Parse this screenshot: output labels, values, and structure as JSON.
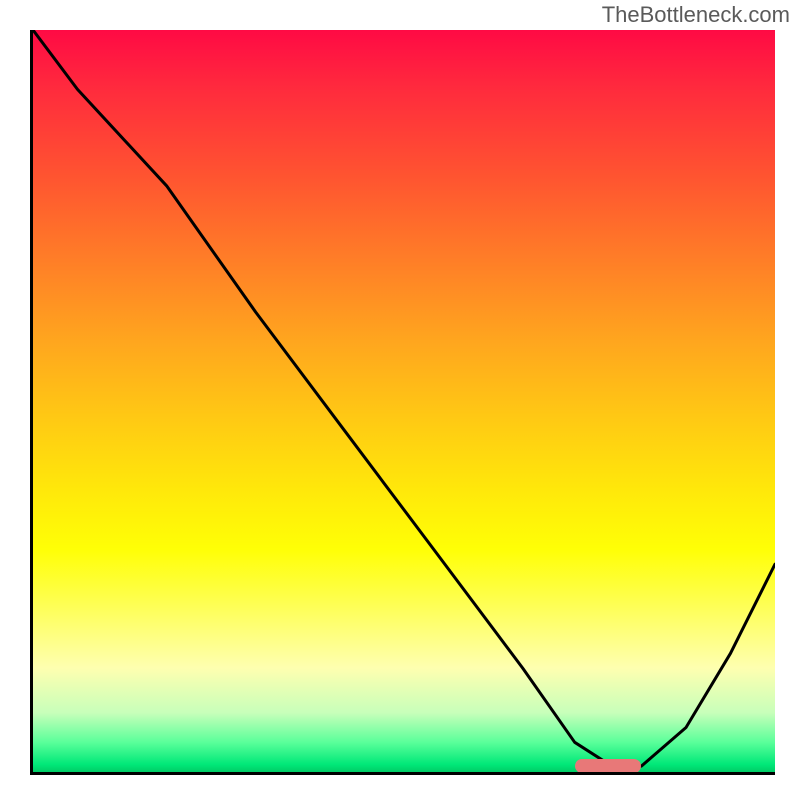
{
  "watermark": "TheBottleneck.com",
  "chart_data": {
    "type": "line",
    "title": "",
    "xlabel": "",
    "ylabel": "",
    "xlim": [
      0,
      100
    ],
    "ylim": [
      0,
      100
    ],
    "grid": false,
    "background_gradient": {
      "direction": "vertical",
      "stops": [
        {
          "pos": 0,
          "color": "#ff0a44"
        },
        {
          "pos": 20,
          "color": "#ff5530"
        },
        {
          "pos": 42,
          "color": "#ffa61e"
        },
        {
          "pos": 62,
          "color": "#ffe80a"
        },
        {
          "pos": 78,
          "color": "#feff5a"
        },
        {
          "pos": 92,
          "color": "#c8ffba"
        },
        {
          "pos": 100,
          "color": "#00cc66"
        }
      ]
    },
    "series": [
      {
        "name": "bottleneck-curve",
        "color": "#000000",
        "x": [
          0,
          6,
          18,
          30,
          42,
          54,
          66,
          73,
          78,
          82,
          88,
          94,
          100
        ],
        "y": [
          100,
          92,
          79,
          62,
          46,
          30,
          14,
          4,
          0.8,
          0.8,
          6,
          16,
          28
        ]
      }
    ],
    "marker": {
      "name": "optimal-range",
      "color": "#e87878",
      "x_start": 73,
      "x_end": 82,
      "y": 0.8
    }
  }
}
